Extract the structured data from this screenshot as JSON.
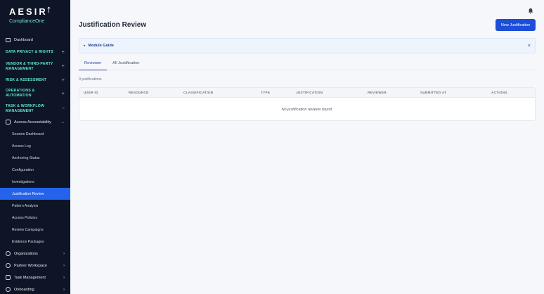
{
  "brand": {
    "name": "AESIR",
    "product": "ComplianceOne"
  },
  "sidebar": {
    "dashboard": "Dashboard",
    "sections": [
      {
        "line1": "DATA PRIVACY & RIGHTS",
        "line2": "",
        "toggle": "+"
      },
      {
        "line1": "VENDOR & THIRD-PARTY",
        "line2": "MANAGEMENT",
        "toggle": "+"
      },
      {
        "line1": "RISK & ASSESSMENT",
        "line2": "",
        "toggle": "+"
      },
      {
        "line1": "OPERATIONS &",
        "line2": "AUTOMATION",
        "toggle": "+"
      },
      {
        "line1": "TASK & WORKFLOW",
        "line2": "MANAGEMENT",
        "toggle": "−"
      }
    ],
    "group_access": "Access Accountability",
    "sub_items": [
      "Session Dashboard",
      "Access Log",
      "Anchoring Status",
      "Configuration",
      "Investigations",
      "Justification Review",
      "Pattern Analysis",
      "Access Policies",
      "Review Campaigns",
      "Evidence Packages"
    ],
    "groups_bottom": [
      "Organizations",
      "Partner Workspace",
      "Task Management",
      "Onboarding"
    ]
  },
  "main": {
    "title": "Justification Review",
    "new_button": "New Justification",
    "guide_label": "Module Guide",
    "guide_close": "×",
    "tabs": [
      "Reviewer",
      "All Justification"
    ],
    "count": "0 justifications",
    "columns": [
      "USER ID",
      "RESOURCE",
      "CLASSIFICATION",
      "TYPE",
      "JUSTIFICATION",
      "REVIEWER",
      "SUBMITTED AT",
      "ACTIONS"
    ],
    "empty": "No justification reviews found."
  },
  "colors": {
    "sidebar_bg": "#0d1526",
    "accent": "#2563eb",
    "section_text": "#5eead4"
  },
  "icons": [
    "dashboard-icon",
    "bell-icon",
    "shield-icon",
    "globe-icon",
    "briefcase-icon",
    "checklist-icon",
    "onboarding-icon"
  ]
}
